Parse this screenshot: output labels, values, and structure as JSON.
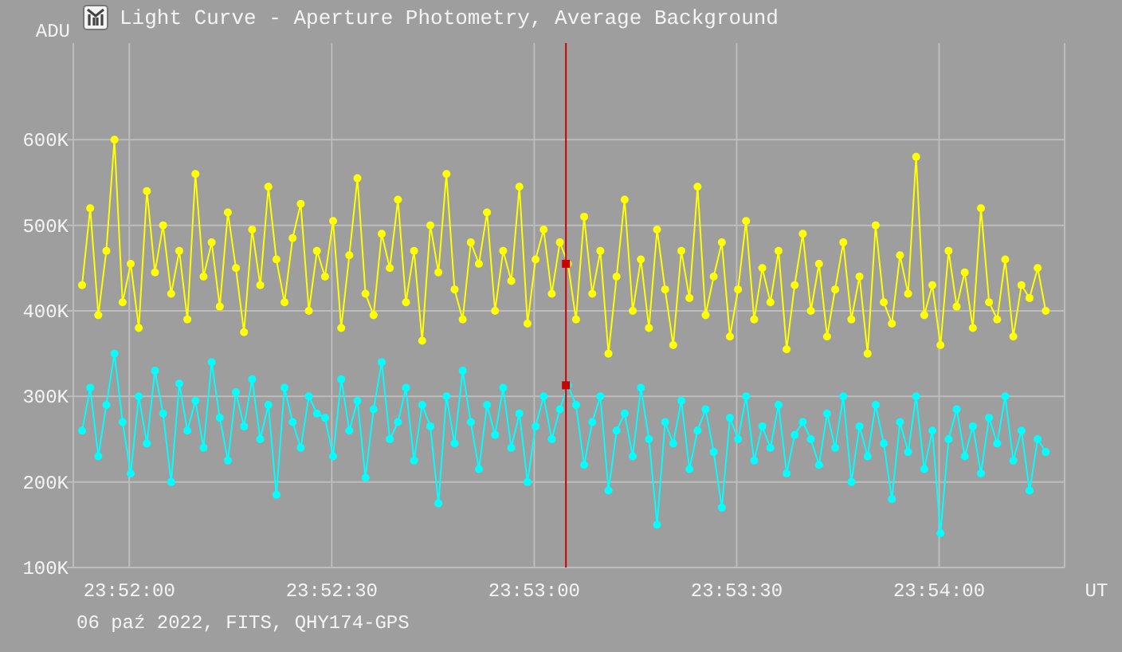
{
  "window": {
    "title": "Light Curve - Aperture Photometry, Average Background"
  },
  "chart": {
    "chart_data": {
      "type": "line",
      "grid": true,
      "xlabel": "UT",
      "ylabel": "ADU",
      "xlim": [
        85911.7,
        86058.6
      ],
      "ylim": [
        100,
        713
      ],
      "xticks": [
        {
          "value": 85920,
          "label": "23:52:00"
        },
        {
          "value": 85950,
          "label": "23:52:30"
        },
        {
          "value": 85980,
          "label": "23:53:00"
        },
        {
          "value": 86010,
          "label": "23:53:30"
        },
        {
          "value": 86040,
          "label": "23:54:00"
        }
      ],
      "yticks": [
        {
          "value": 100,
          "label": "100K"
        },
        {
          "value": 200,
          "label": "200K"
        },
        {
          "value": 300,
          "label": "300K"
        },
        {
          "value": 400,
          "label": "400K"
        },
        {
          "value": 500,
          "label": "500K"
        },
        {
          "value": 600,
          "label": "600K"
        }
      ],
      "x": [
        85913,
        85914.2,
        85915.4,
        85916.6,
        85917.8,
        85919,
        85920.2,
        85921.4,
        85922.6,
        85923.8,
        85925,
        85926.2,
        85927.4,
        85928.6,
        85929.8,
        85931,
        85932.2,
        85933.4,
        85934.6,
        85935.8,
        85937,
        85938.2,
        85939.4,
        85940.6,
        85941.8,
        85943,
        85944.2,
        85945.4,
        85946.6,
        85947.8,
        85949,
        85950.2,
        85951.4,
        85952.6,
        85953.8,
        85955,
        85956.2,
        85957.4,
        85958.6,
        85959.8,
        85961,
        85962.2,
        85963.4,
        85964.6,
        85965.8,
        85967,
        85968.2,
        85969.4,
        85970.6,
        85971.8,
        85973,
        85974.2,
        85975.4,
        85976.6,
        85977.8,
        85979,
        85980.2,
        85981.4,
        85982.6,
        85983.8,
        85985,
        85986.2,
        85987.4,
        85988.6,
        85989.8,
        85991,
        85992.2,
        85993.4,
        85994.6,
        85995.8,
        85997,
        85998.2,
        85999.4,
        86000.6,
        86001.8,
        86003,
        86004.2,
        86005.4,
        86006.6,
        86007.8,
        86009,
        86010.2,
        86011.4,
        86012.6,
        86013.8,
        86015,
        86016.2,
        86017.4,
        86018.6,
        86019.8,
        86021,
        86022.2,
        86023.4,
        86024.6,
        86025.8,
        86027,
        86028.2,
        86029.4,
        86030.6,
        86031.8,
        86033,
        86034.2,
        86035.4,
        86036.6,
        86037.8,
        86039,
        86040.2,
        86041.4,
        86042.6,
        86043.8,
        86045,
        86046.2,
        86047.4,
        86048.6,
        86049.8,
        86051,
        86052.2,
        86053.4,
        86054.6,
        86055.8
      ],
      "series": [
        {
          "color": "#00ffff",
          "marker": "o",
          "values": [
            260,
            310,
            230,
            290,
            350,
            270,
            210,
            300,
            245,
            330,
            280,
            200,
            315,
            260,
            295,
            240,
            340,
            275,
            225,
            305,
            265,
            320,
            250,
            290,
            185,
            310,
            270,
            240,
            300,
            280,
            275,
            230,
            320,
            260,
            295,
            205,
            285,
            340,
            250,
            270,
            310,
            225,
            290,
            265,
            175,
            300,
            245,
            330,
            270,
            215,
            290,
            255,
            310,
            240,
            280,
            200,
            265,
            300,
            250,
            285,
            313,
            290,
            220,
            270,
            300,
            190,
            260,
            280,
            230,
            310,
            250,
            150,
            270,
            245,
            295,
            215,
            260,
            285,
            235,
            170,
            275,
            250,
            300,
            225,
            265,
            240,
            290,
            210,
            255,
            270,
            250,
            220,
            280,
            240,
            300,
            200,
            265,
            230,
            290,
            245,
            180,
            270,
            235,
            300,
            215,
            260,
            140,
            250,
            285,
            230,
            265,
            210,
            275,
            245,
            300,
            225,
            260,
            190,
            250,
            235
          ]
        },
        {
          "color": "#ffff00",
          "marker": "o",
          "values": [
            430,
            520,
            395,
            470,
            600,
            410,
            455,
            380,
            540,
            445,
            500,
            420,
            470,
            390,
            560,
            440,
            480,
            405,
            515,
            450,
            375,
            495,
            430,
            545,
            460,
            410,
            485,
            525,
            400,
            470,
            440,
            505,
            380,
            465,
            555,
            420,
            395,
            490,
            450,
            530,
            410,
            470,
            365,
            500,
            445,
            560,
            425,
            390,
            480,
            455,
            515,
            400,
            470,
            435,
            545,
            385,
            460,
            495,
            420,
            480,
            455,
            390,
            510,
            420,
            470,
            350,
            440,
            530,
            400,
            460,
            380,
            495,
            425,
            360,
            470,
            415,
            545,
            395,
            440,
            480,
            370,
            425,
            505,
            390,
            450,
            410,
            470,
            355,
            430,
            490,
            400,
            455,
            370,
            425,
            480,
            390,
            440,
            350,
            500,
            410,
            385,
            465,
            420,
            580,
            395,
            430,
            360,
            470,
            405,
            445,
            380,
            520,
            410,
            390,
            460,
            370,
            430,
            415,
            450,
            400
          ]
        }
      ],
      "ref_lines": [
        {
          "axis": "x",
          "value": 85984.7,
          "color": "#cc0000"
        }
      ]
    }
  },
  "footer": {
    "text": "06 paź 2022, FITS, QHY174-GPS"
  }
}
